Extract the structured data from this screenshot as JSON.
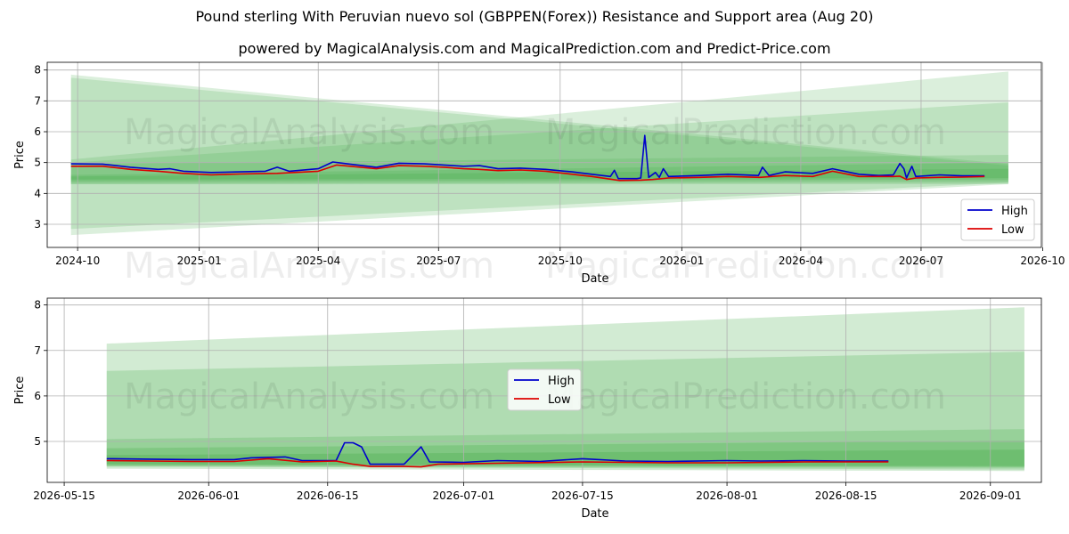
{
  "title": "Pound sterling With Peruvian nuevo sol (GBPPEN(Forex)) Resistance and Support area (Aug 20)",
  "subtitle": "powered by MagicalAnalysis.com and MagicalPrediction.com and Predict-Price.com",
  "watermarks": [
    "MagicalAnalysis.com",
    "MagicalPrediction.com"
  ],
  "colors": {
    "high": "#0000cc",
    "low": "#dd0000",
    "band": "#4caf50",
    "grid": "#b0b0b0"
  },
  "chart_data": [
    {
      "type": "line",
      "xlabel": "Date",
      "ylabel": "Price",
      "xlim": [
        "2024-09-08",
        "2026-09-30"
      ],
      "ylim": [
        2.25,
        8.25
      ],
      "x_ticks": [
        "2024-10-01",
        "2025-01-01",
        "2025-04-01",
        "2025-07-01",
        "2025-10-01",
        "2026-01-01",
        "2026-04-01",
        "2026-07-01",
        "2026-10-01"
      ],
      "x_tick_labels": [
        "2024-10",
        "2025-01",
        "2025-04",
        "2025-07",
        "2025-10",
        "2026-01",
        "2026-04",
        "2026-07",
        "2026-10"
      ],
      "y_ticks": [
        3,
        4,
        5,
        6,
        7,
        8
      ],
      "y_tick_labels": [
        "3",
        "4",
        "5",
        "6",
        "7",
        "8"
      ],
      "grid": true,
      "legend_position": "lower-right",
      "series": [
        {
          "name": "High",
          "points": [
            [
              "2024-09-26",
              4.96
            ],
            [
              "2024-10-20",
              4.95
            ],
            [
              "2024-11-10",
              4.85
            ],
            [
              "2024-12-01",
              4.78
            ],
            [
              "2024-12-10",
              4.8
            ],
            [
              "2024-12-20",
              4.72
            ],
            [
              "2025-01-10",
              4.68
            ],
            [
              "2025-02-01",
              4.7
            ],
            [
              "2025-02-20",
              4.72
            ],
            [
              "2025-03-01",
              4.85
            ],
            [
              "2025-03-10",
              4.72
            ],
            [
              "2025-04-01",
              4.8
            ],
            [
              "2025-04-12",
              5.02
            ],
            [
              "2025-04-25",
              4.95
            ],
            [
              "2025-05-15",
              4.85
            ],
            [
              "2025-06-01",
              4.98
            ],
            [
              "2025-06-20",
              4.96
            ],
            [
              "2025-07-05",
              4.92
            ],
            [
              "2025-07-20",
              4.88
            ],
            [
              "2025-08-01",
              4.9
            ],
            [
              "2025-08-15",
              4.8
            ],
            [
              "2025-09-01",
              4.82
            ],
            [
              "2025-09-20",
              4.78
            ],
            [
              "2025-10-10",
              4.7
            ],
            [
              "2025-10-25",
              4.62
            ],
            [
              "2025-11-08",
              4.55
            ],
            [
              "2025-11-11",
              4.75
            ],
            [
              "2025-11-14",
              4.48
            ],
            [
              "2025-11-28",
              4.48
            ],
            [
              "2025-12-01",
              4.5
            ],
            [
              "2025-12-04",
              5.88
            ],
            [
              "2025-12-07",
              4.52
            ],
            [
              "2025-12-12",
              4.68
            ],
            [
              "2025-12-15",
              4.52
            ],
            [
              "2025-12-18",
              4.8
            ],
            [
              "2025-12-22",
              4.55
            ],
            [
              "2026-01-15",
              4.58
            ],
            [
              "2026-02-05",
              4.62
            ],
            [
              "2026-02-28",
              4.58
            ],
            [
              "2026-03-03",
              4.85
            ],
            [
              "2026-03-08",
              4.58
            ],
            [
              "2026-03-20",
              4.7
            ],
            [
              "2026-04-10",
              4.65
            ],
            [
              "2026-04-25",
              4.8
            ],
            [
              "2026-05-15",
              4.62
            ],
            [
              "2026-05-30",
              4.58
            ],
            [
              "2026-06-10",
              4.6
            ],
            [
              "2026-06-15",
              4.97
            ],
            [
              "2026-06-18",
              4.8
            ],
            [
              "2026-06-20",
              4.5
            ],
            [
              "2026-06-24",
              4.88
            ],
            [
              "2026-06-27",
              4.55
            ],
            [
              "2026-07-15",
              4.6
            ],
            [
              "2026-08-01",
              4.57
            ],
            [
              "2026-08-18",
              4.57
            ]
          ]
        },
        {
          "name": "Low",
          "points": [
            [
              "2024-09-26",
              4.88
            ],
            [
              "2024-10-20",
              4.88
            ],
            [
              "2024-11-10",
              4.78
            ],
            [
              "2024-12-01",
              4.72
            ],
            [
              "2024-12-20",
              4.65
            ],
            [
              "2025-01-10",
              4.6
            ],
            [
              "2025-02-01",
              4.63
            ],
            [
              "2025-03-01",
              4.65
            ],
            [
              "2025-04-01",
              4.72
            ],
            [
              "2025-04-15",
              4.92
            ],
            [
              "2025-05-15",
              4.8
            ],
            [
              "2025-06-01",
              4.9
            ],
            [
              "2025-06-20",
              4.88
            ],
            [
              "2025-07-05",
              4.85
            ],
            [
              "2025-07-20",
              4.8
            ],
            [
              "2025-08-01",
              4.78
            ],
            [
              "2025-08-15",
              4.74
            ],
            [
              "2025-09-01",
              4.76
            ],
            [
              "2025-09-20",
              4.72
            ],
            [
              "2025-10-10",
              4.62
            ],
            [
              "2025-10-25",
              4.55
            ],
            [
              "2025-11-15",
              4.42
            ],
            [
              "2025-12-01",
              4.43
            ],
            [
              "2025-12-10",
              4.45
            ],
            [
              "2025-12-22",
              4.5
            ],
            [
              "2026-01-15",
              4.52
            ],
            [
              "2026-02-05",
              4.55
            ],
            [
              "2026-03-01",
              4.52
            ],
            [
              "2026-03-20",
              4.58
            ],
            [
              "2026-04-10",
              4.55
            ],
            [
              "2026-04-25",
              4.72
            ],
            [
              "2026-05-15",
              4.55
            ],
            [
              "2026-06-10",
              4.55
            ],
            [
              "2026-06-15",
              4.56
            ],
            [
              "2026-06-20",
              4.45
            ],
            [
              "2026-06-27",
              4.5
            ],
            [
              "2026-07-15",
              4.52
            ],
            [
              "2026-08-01",
              4.53
            ],
            [
              "2026-08-18",
              4.55
            ]
          ]
        }
      ],
      "bands": [
        {
          "x": [
            "2024-09-26",
            "2026-09-05"
          ],
          "upper": [
            7.85,
            4.95
          ],
          "lower": [
            2.65,
            4.3
          ],
          "opacity": 0.2
        },
        {
          "x": [
            "2024-09-26",
            "2026-09-05"
          ],
          "upper": [
            7.75,
            4.9
          ],
          "lower": [
            2.85,
            4.35
          ],
          "opacity": 0.2
        },
        {
          "x": [
            "2024-09-26",
            "2026-09-05"
          ],
          "upper": [
            5.1,
            7.95
          ],
          "lower": [
            4.3,
            4.3
          ],
          "opacity": 0.2
        },
        {
          "x": [
            "2024-09-26",
            "2026-09-05"
          ],
          "upper": [
            5.0,
            6.95
          ],
          "lower": [
            4.3,
            4.35
          ],
          "opacity": 0.2
        },
        {
          "x": [
            "2024-09-26",
            "2026-09-05"
          ],
          "upper": [
            4.95,
            5.25
          ],
          "lower": [
            4.35,
            4.4
          ],
          "opacity": 0.2
        },
        {
          "x": [
            "2024-09-26",
            "2026-09-05"
          ],
          "upper": [
            4.6,
            5.0
          ],
          "lower": [
            4.4,
            4.45
          ],
          "opacity": 0.25
        },
        {
          "x": [
            "2024-09-26",
            "2026-09-05"
          ],
          "upper": [
            4.55,
            4.8
          ],
          "lower": [
            4.45,
            4.5
          ],
          "opacity": 0.3
        }
      ]
    },
    {
      "type": "line",
      "xlabel": "Date",
      "ylabel": "Price",
      "xlim": [
        "2026-05-13",
        "2026-09-07"
      ],
      "ylim": [
        4.1,
        8.15
      ],
      "x_ticks": [
        "2026-05-15",
        "2026-06-01",
        "2026-06-15",
        "2026-07-01",
        "2026-07-15",
        "2026-08-01",
        "2026-08-15",
        "2026-09-01"
      ],
      "x_tick_labels": [
        "2026-05-15",
        "2026-06-01",
        "2026-06-15",
        "2026-07-01",
        "2026-07-15",
        "2026-08-01",
        "2026-08-15",
        "2026-09-01"
      ],
      "y_ticks": [
        5,
        6,
        7,
        8
      ],
      "y_tick_labels": [
        "5",
        "6",
        "7",
        "8"
      ],
      "grid": true,
      "legend_position": "center",
      "series": [
        {
          "name": "High",
          "points": [
            [
              "2026-05-20",
              4.62
            ],
            [
              "2026-05-25",
              4.61
            ],
            [
              "2026-05-30",
              4.6
            ],
            [
              "2026-06-04",
              4.6
            ],
            [
              "2026-06-06",
              4.64
            ],
            [
              "2026-06-10",
              4.66
            ],
            [
              "2026-06-12",
              4.58
            ],
            [
              "2026-06-16",
              4.58
            ],
            [
              "2026-06-17",
              4.97
            ],
            [
              "2026-06-18",
              4.97
            ],
            [
              "2026-06-19",
              4.88
            ],
            [
              "2026-06-20",
              4.5
            ],
            [
              "2026-06-22",
              4.5
            ],
            [
              "2026-06-24",
              4.5
            ],
            [
              "2026-06-26",
              4.88
            ],
            [
              "2026-06-27",
              4.55
            ],
            [
              "2026-07-01",
              4.54
            ],
            [
              "2026-07-05",
              4.58
            ],
            [
              "2026-07-10",
              4.56
            ],
            [
              "2026-07-15",
              4.62
            ],
            [
              "2026-07-20",
              4.57
            ],
            [
              "2026-07-25",
              4.56
            ],
            [
              "2026-08-01",
              4.58
            ],
            [
              "2026-08-05",
              4.57
            ],
            [
              "2026-08-10",
              4.58
            ],
            [
              "2026-08-15",
              4.57
            ],
            [
              "2026-08-20",
              4.57
            ]
          ]
        },
        {
          "name": "Low",
          "points": [
            [
              "2026-05-20",
              4.58
            ],
            [
              "2026-05-25",
              4.57
            ],
            [
              "2026-05-30",
              4.56
            ],
            [
              "2026-06-04",
              4.56
            ],
            [
              "2026-06-08",
              4.62
            ],
            [
              "2026-06-12",
              4.55
            ],
            [
              "2026-06-16",
              4.57
            ],
            [
              "2026-06-18",
              4.5
            ],
            [
              "2026-06-20",
              4.45
            ],
            [
              "2026-06-24",
              4.45
            ],
            [
              "2026-06-26",
              4.44
            ],
            [
              "2026-06-28",
              4.5
            ],
            [
              "2026-07-05",
              4.52
            ],
            [
              "2026-07-15",
              4.55
            ],
            [
              "2026-07-25",
              4.53
            ],
            [
              "2026-08-01",
              4.53
            ],
            [
              "2026-08-10",
              4.55
            ],
            [
              "2026-08-20",
              4.55
            ]
          ]
        }
      ],
      "bands": [
        {
          "x": [
            "2026-05-20",
            "2026-09-05"
          ],
          "upper": [
            7.15,
            7.95
          ],
          "lower": [
            4.4,
            4.35
          ],
          "opacity": 0.25
        },
        {
          "x": [
            "2026-05-20",
            "2026-09-05"
          ],
          "upper": [
            6.55,
            6.97
          ],
          "lower": [
            4.45,
            4.38
          ],
          "opacity": 0.25
        },
        {
          "x": [
            "2026-05-20",
            "2026-09-05"
          ],
          "upper": [
            5.05,
            5.27
          ],
          "lower": [
            4.45,
            4.42
          ],
          "opacity": 0.25
        },
        {
          "x": [
            "2026-05-20",
            "2026-09-05"
          ],
          "upper": [
            4.85,
            5.02
          ],
          "lower": [
            4.48,
            4.44
          ],
          "opacity": 0.3
        },
        {
          "x": [
            "2026-05-20",
            "2026-09-05"
          ],
          "upper": [
            4.7,
            4.82
          ],
          "lower": [
            4.5,
            4.46
          ],
          "opacity": 0.35
        }
      ]
    }
  ]
}
